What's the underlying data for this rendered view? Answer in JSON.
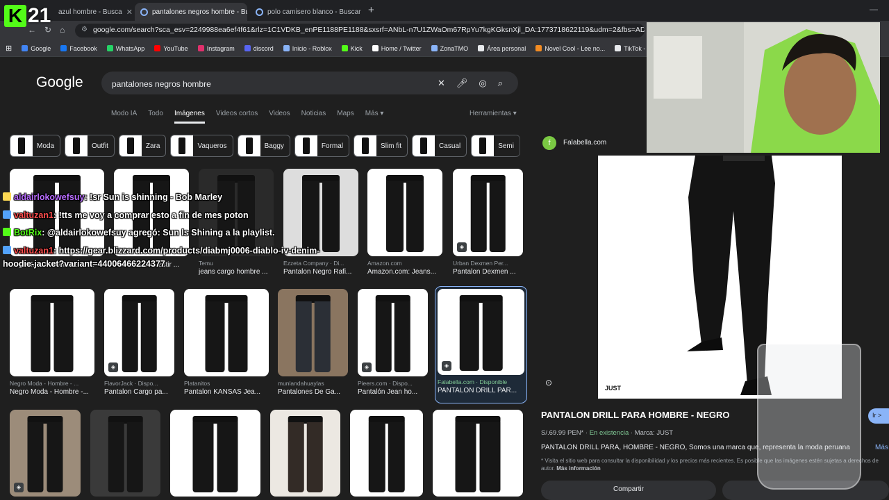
{
  "browser": {
    "tabs": [
      {
        "label": "azul hombre - Busca",
        "active": false
      },
      {
        "label": "pantalones negros hombre - Bu",
        "active": true
      },
      {
        "label": "polo camisero blanco - Buscar",
        "active": false
      }
    ],
    "new_tab": "+",
    "url": "google.com/search?sca_esv=2249988ea6ef4f61&rlz=1C1VDKB_enPE1188PE1188&sxsrf=ANbL-n7U1ZWaOm67RpYu7kgKGksnXjl_DA:1773718622119&udm=2&fbs=ADc_l-bpk8W4E-qsV",
    "bookmarks": [
      {
        "label": "Google",
        "color": "#4285f4"
      },
      {
        "label": "Facebook",
        "color": "#1877f2"
      },
      {
        "label": "WhatsApp",
        "color": "#25d366"
      },
      {
        "label": "YouTube",
        "color": "#ff0000"
      },
      {
        "label": "Instagram",
        "color": "#e1306c"
      },
      {
        "label": "discord",
        "color": "#5865f2"
      },
      {
        "label": "Inicio - Roblox",
        "color": "#8ab4f8"
      },
      {
        "label": "Kick",
        "color": "#53fc18"
      },
      {
        "label": "Home / Twitter",
        "color": "#ffffff"
      },
      {
        "label": "ZonaTMO",
        "color": "#8ab4f8"
      },
      {
        "label": "Área personal",
        "color": "#e8eaed"
      },
      {
        "label": "Novel Cool - Lee no...",
        "color": "#f28b22"
      },
      {
        "label": "TikTok - Alegra tu",
        "color": "#e8eaed"
      }
    ]
  },
  "google": {
    "logo": "Google",
    "query": "pantalones negros hombre",
    "nav_tabs": [
      "Modo IA",
      "Todo",
      "Imágenes",
      "Videos cortos",
      "Videos",
      "Noticias",
      "Maps",
      "Más ▾"
    ],
    "active_tab": "Imágenes",
    "tools": "Herramientas ▾",
    "chips": [
      "Moda",
      "Outfit",
      "Zara",
      "Vaqueros",
      "Baggy",
      "Formal",
      "Slim fit",
      "Casual",
      "Semi"
    ]
  },
  "results": {
    "row1": [
      {
        "source": "",
        "title": "Negro Moda - Hombre - P..."
      },
      {
        "source": "",
        "title": "Pantalon De Vestir ..."
      },
      {
        "source": "Temu",
        "title": "jeans cargo hombre ..."
      },
      {
        "source": "Ezzeta Company · Di...",
        "title": "Pantalon Negro Rafi..."
      },
      {
        "source": "Amazon.com",
        "title": "Amazon.com: Jeans..."
      },
      {
        "source": "Urban Dexmen Per...",
        "title": "Pantalon Dexmen ..."
      }
    ],
    "row2": [
      {
        "source": "Negro Moda - Hombre - ...",
        "title": "Negro Moda - Hombre -..."
      },
      {
        "source": "FlavorJack · Dispo...",
        "title": "Pantalon Cargo pa..."
      },
      {
        "source": "Platanitos",
        "title": "Pantalon KANSAS Jea..."
      },
      {
        "source": "munlandahuaylas",
        "title": "Pantalones De Ga..."
      },
      {
        "source": "Pieers.com · Dispo...",
        "title": "Pantalón Jean ho..."
      },
      {
        "source": "Falabella.com · Disponible",
        "title": "PANTALON DRILL PAR..."
      }
    ]
  },
  "panel": {
    "site": "Falabella.com",
    "title": "PANTALON DRILL PARA HOMBRE - NEGRO",
    "price": "S/.69.99 PEN*",
    "stock": "En existencia",
    "brand": "Marca: JUST",
    "description": "PANTALON DRILL PARA, HOMBRE - NEGRO, Somos una marca que, representa la moda peruana",
    "more": "Más",
    "notice": "* Visita el sitio web para consultar la disponibilidad y los precios más recientes. Es posible que las imágenes estén sujetas a derechos de autor.",
    "notice_link": "Más información",
    "visit": "Ir >",
    "share": "Compartir",
    "image_logo": "JUST"
  },
  "stream": {
    "channel_logo": "K",
    "channel_number": "21",
    "chat": [
      {
        "user": "aldairlokowefsuy",
        "user_color": "#b86cff",
        "text": ": !sr Sun is shinning - Bob Marley",
        "badge": "y"
      },
      {
        "user": "valtuzan1",
        "user_color": "#ff4d4d",
        "text": ": !tts me voy a comprar esto a fin de mes poton",
        "badge": ""
      },
      {
        "user": "BotRix",
        "user_color": "#53fc18",
        "text": ": @aldairlokowefsuy agregó: Sun Is Shining a la playlist.",
        "badge": "g"
      },
      {
        "user": "valtuzan1",
        "user_color": "#ff4d4d",
        "text": ": https://gear.blizzard.com/products/diabmj0006-diablo-iv-denim-",
        "badge": ""
      }
    ],
    "chat_overflow": "hoodie-jacket?variant=44006466224377"
  }
}
